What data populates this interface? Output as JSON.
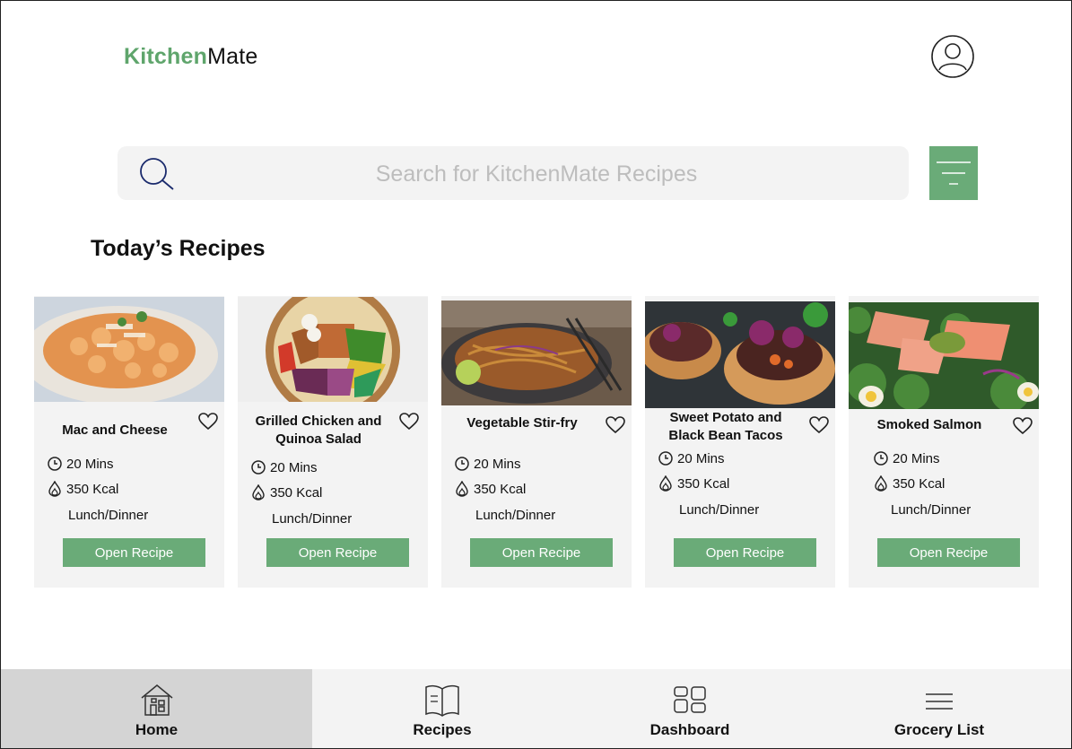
{
  "header": {
    "brand_accent": "Kitchen",
    "brand_rest": "Mate"
  },
  "search": {
    "placeholder": "Search for KitchenMate Recipes",
    "value": ""
  },
  "section_title": "Today’s Recipes",
  "recipes": [
    {
      "title": "Mac and Cheese",
      "time": "20 Mins",
      "calories": "350 Kcal",
      "meal": "Lunch/Dinner",
      "button": "Open Recipe"
    },
    {
      "title": "Grilled Chicken and Quinoa Salad",
      "time": "20 Mins",
      "calories": "350 Kcal",
      "meal": "Lunch/Dinner",
      "button": "Open Recipe"
    },
    {
      "title": "Vegetable Stir-fry",
      "time": "20 Mins",
      "calories": "350 Kcal",
      "meal": "Lunch/Dinner",
      "button": "Open Recipe"
    },
    {
      "title": "Sweet Potato and Black Bean Tacos",
      "time": "20 Mins",
      "calories": "350 Kcal",
      "meal": "Lunch/Dinner",
      "button": "Open Recipe"
    },
    {
      "title": "Smoked Salmon",
      "time": "20 Mins",
      "calories": "350 Kcal",
      "meal": "Lunch/Dinner",
      "button": "Open Recipe"
    }
  ],
  "nav": {
    "items": [
      {
        "label": "Home",
        "icon": "house-icon",
        "active": true
      },
      {
        "label": "Recipes",
        "icon": "open-book-icon",
        "active": false
      },
      {
        "label": "Dashboard",
        "icon": "dashboard-grid-icon",
        "active": false
      },
      {
        "label": "Grocery List",
        "icon": "list-lines-icon",
        "active": false
      }
    ]
  },
  "colors": {
    "accent": "#6aab78",
    "brand_green": "#5fa56c",
    "panel": "#f3f3f3",
    "nav_active": "#d4d4d4"
  }
}
